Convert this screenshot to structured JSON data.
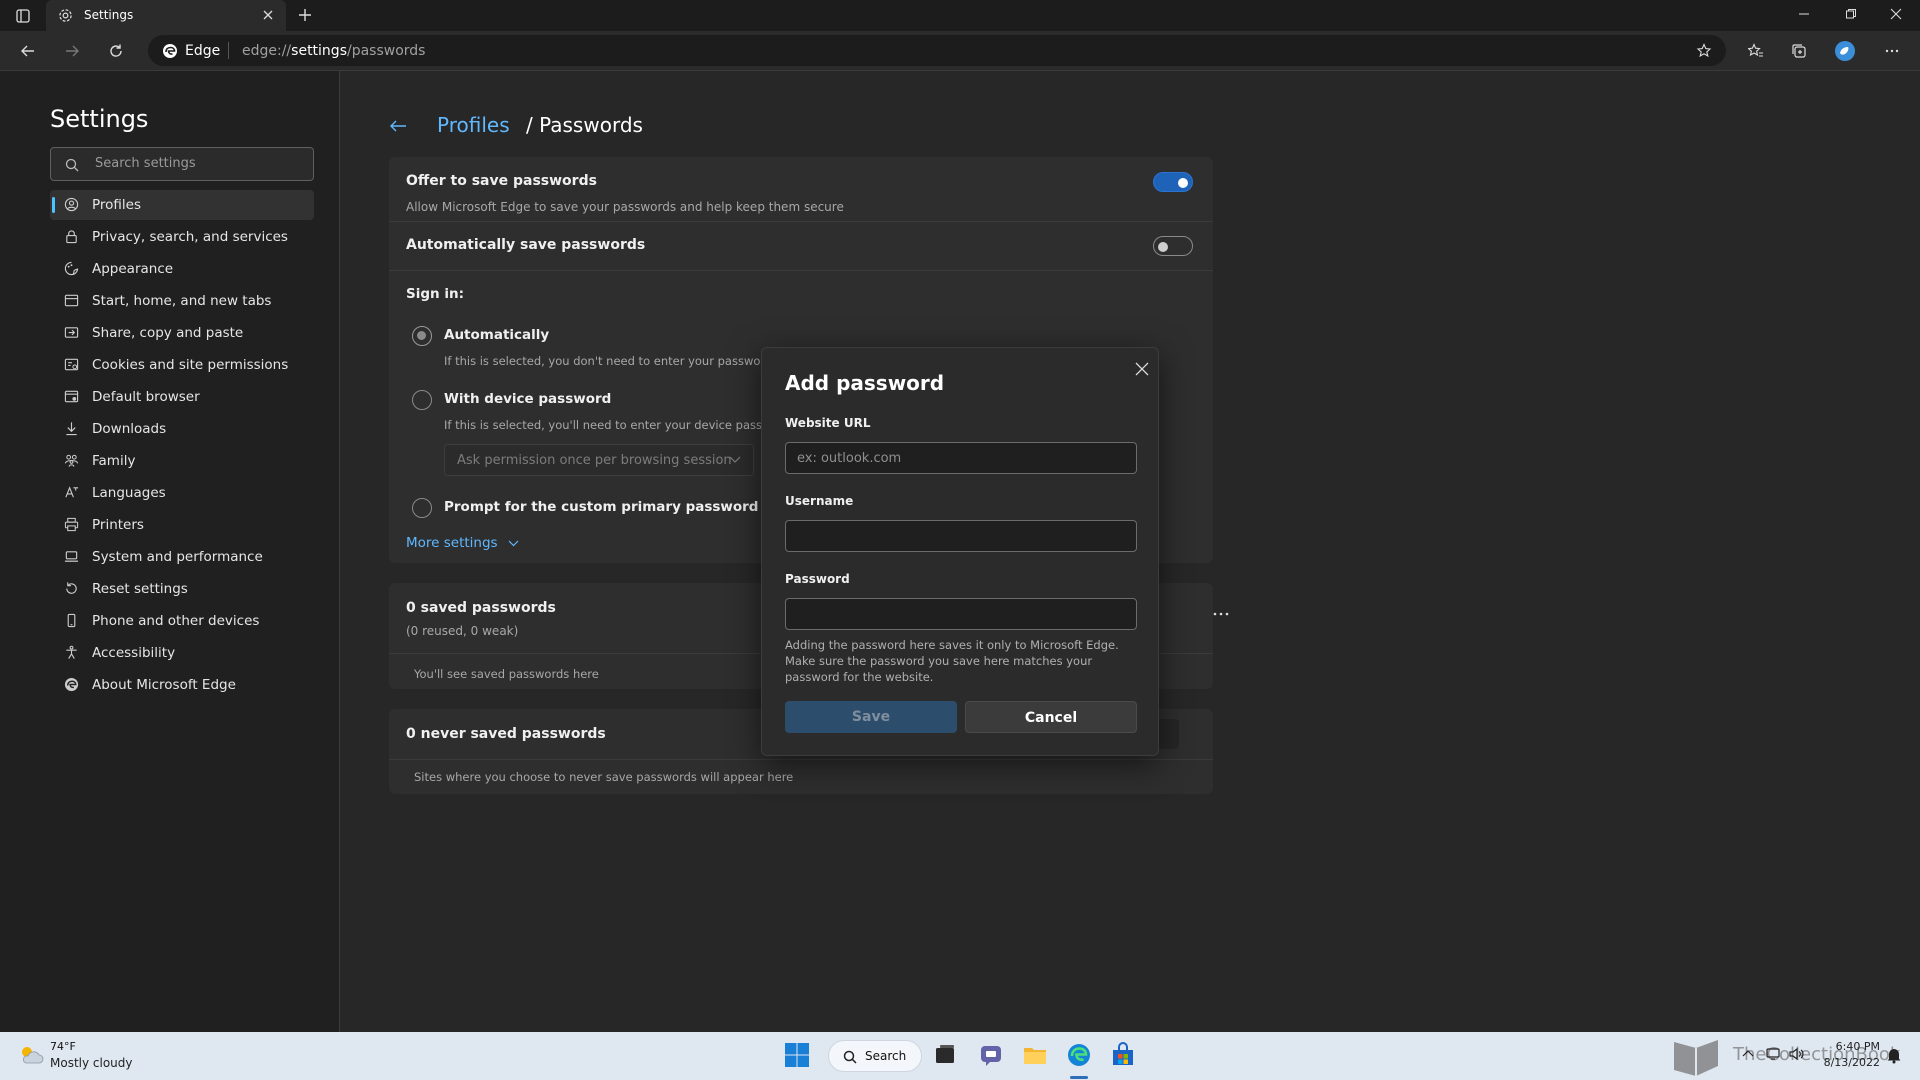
{
  "browser": {
    "tab_title": "Settings",
    "site_label": "Edge",
    "url_prefix": "edge://",
    "url_path": "settings",
    "url_suffix": "/passwords"
  },
  "sidebar": {
    "title": "Settings",
    "search_placeholder": "Search settings",
    "items": [
      {
        "label": "Profiles",
        "icon": "person-icon"
      },
      {
        "label": "Privacy, search, and services",
        "icon": "lock-icon"
      },
      {
        "label": "Appearance",
        "icon": "appearance-icon"
      },
      {
        "label": "Start, home, and new tabs",
        "icon": "home-icon"
      },
      {
        "label": "Share, copy and paste",
        "icon": "share-icon"
      },
      {
        "label": "Cookies and site permissions",
        "icon": "cookie-icon"
      },
      {
        "label": "Default browser",
        "icon": "browser-icon"
      },
      {
        "label": "Downloads",
        "icon": "download-icon"
      },
      {
        "label": "Family",
        "icon": "family-icon"
      },
      {
        "label": "Languages",
        "icon": "language-icon"
      },
      {
        "label": "Printers",
        "icon": "printer-icon"
      },
      {
        "label": "System and performance",
        "icon": "laptop-icon"
      },
      {
        "label": "Reset settings",
        "icon": "reset-icon"
      },
      {
        "label": "Phone and other devices",
        "icon": "phone-icon"
      },
      {
        "label": "Accessibility",
        "icon": "accessibility-icon"
      },
      {
        "label": "About Microsoft Edge",
        "icon": "edge-icon"
      }
    ]
  },
  "main": {
    "breadcrumb_link": "Profiles",
    "breadcrumb_current": "/ Passwords",
    "offer_title": "Offer to save passwords",
    "offer_sub": "Allow Microsoft Edge to save your passwords and help keep them secure",
    "offer_on": true,
    "auto_title": "Automatically save passwords",
    "auto_on": false,
    "signin_label": "Sign in:",
    "option_auto": "Automatically",
    "option_auto_sub": "If this is selected, you don't need to enter your password be",
    "option_device": "With device password",
    "option_device_sub": "If this is selected, you'll need to enter your device password",
    "device_dropdown": "Ask permission once per browsing session",
    "option_custom": "Prompt for the custom primary password before f",
    "more_settings": "More settings",
    "saved_title": "0 saved passwords",
    "saved_sub": "(0 reused, 0 weak)",
    "saved_empty": "You'll see saved passwords here",
    "never_title": "0 never saved passwords",
    "never_empty": "Sites where you choose to never save passwords will appear here"
  },
  "dialog": {
    "title": "Add password",
    "url_label": "Website URL",
    "url_placeholder": "ex: outlook.com",
    "username_label": "Username",
    "password_label": "Password",
    "note": "Adding the password here saves it only to Microsoft Edge. Make sure the password you save here matches your password for the website.",
    "save_label": "Save",
    "cancel_label": "Cancel"
  },
  "taskbar": {
    "temperature": "74°F",
    "condition": "Mostly cloudy",
    "search_label": "Search",
    "time": "6:40 PM",
    "date": "8/13/2022",
    "watermark": "TheCollectionBook"
  },
  "colors": {
    "accent": "#4cc2ff",
    "link": "#60b8ff",
    "toggle_on": "#1e63b8"
  }
}
